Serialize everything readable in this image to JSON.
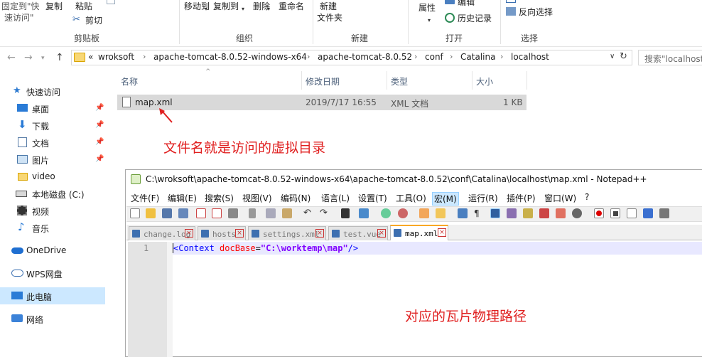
{
  "ribbon": {
    "pin_quick_access": "固定到\"快\n速访问\"",
    "pin_quick_access_line1": "固定到\"快",
    "pin_quick_access_line2": "速访问\"",
    "copy": "复制",
    "paste": "粘贴",
    "cut": "剪切",
    "clipboard_group": "剪贴板",
    "move_to": "移动到",
    "copy_to": "复制到",
    "delete": "删除",
    "rename": "重命名",
    "organize_group": "组织",
    "new_folder_line1": "新建",
    "new_folder_line2": "文件夹",
    "new_group": "新建",
    "properties": "属性",
    "edit": "编辑",
    "history": "历史记录",
    "open_group": "打开",
    "invert_select": "反向选择",
    "select_group": "选择"
  },
  "address": {
    "overflow": "«",
    "crumbs": [
      "wroksoft",
      "apache-tomcat-8.0.52-windows-x64",
      "apache-tomcat-8.0.52",
      "conf",
      "Catalina",
      "localhost"
    ],
    "search_placeholder": "搜索\"localhost\""
  },
  "nav": {
    "items": [
      {
        "label": "快速访问"
      },
      {
        "label": "桌面"
      },
      {
        "label": "下载"
      },
      {
        "label": "文档"
      },
      {
        "label": "图片"
      },
      {
        "label": "video"
      },
      {
        "label": "本地磁盘 (C:)"
      },
      {
        "label": "视频"
      },
      {
        "label": "音乐"
      },
      {
        "label": "OneDrive"
      },
      {
        "label": "WPS网盘"
      },
      {
        "label": "此电脑"
      },
      {
        "label": "网络"
      }
    ]
  },
  "columns": {
    "name": "名称",
    "modified": "修改日期",
    "type": "类型",
    "size": "大小"
  },
  "file": {
    "name": "map.xml",
    "modified": "2019/7/17 16:55",
    "type": "XML 文档",
    "size": "1 KB"
  },
  "annotations": {
    "top": "文件名就是访问的虚拟目录",
    "bottom": "对应的瓦片物理路径"
  },
  "notepad": {
    "title": "C:\\wroksoft\\apache-tomcat-8.0.52-windows-x64\\apache-tomcat-8.0.52\\conf\\Catalina\\localhost\\map.xml - Notepad++",
    "menu": [
      "文件(F)",
      "编辑(E)",
      "搜索(S)",
      "视图(V)",
      "编码(N)",
      "语言(L)",
      "设置(T)",
      "工具(O)",
      "宏(M)",
      "运行(R)",
      "插件(P)",
      "窗口(W)",
      "?"
    ],
    "tabs": [
      "change.log",
      "hosts",
      "settings.xml",
      "test.vue",
      "map.xml"
    ],
    "line_number": "1",
    "code": {
      "open": "<Context ",
      "attr": "docBase",
      "eq": "=",
      "value": "\"C:\\worktemp\\map\"",
      "close": "/>"
    }
  },
  "colors": {
    "accent_red": "#e02020",
    "selection": "#cce8ff",
    "xml_tag": "#0000ff",
    "xml_attr": "#ff0000",
    "xml_value": "#8000ff"
  }
}
